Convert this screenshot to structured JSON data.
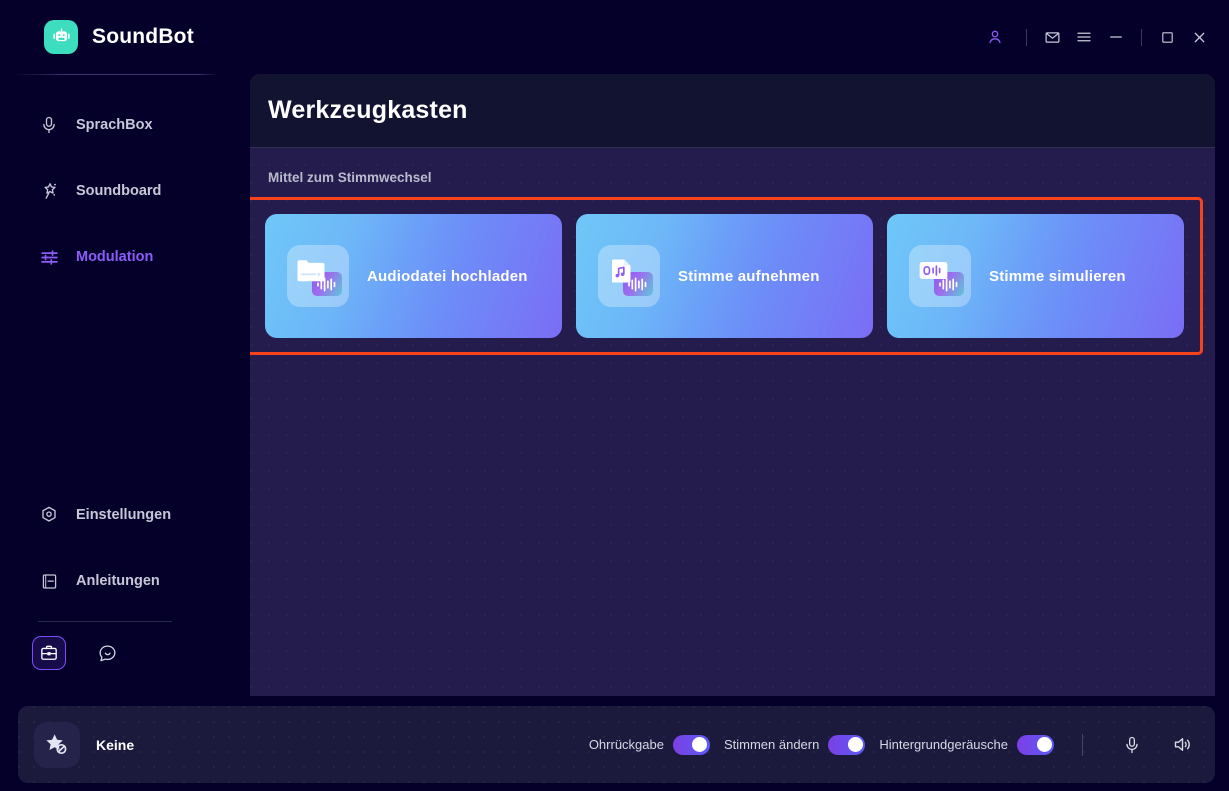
{
  "app": {
    "brand_name": "SoundBot",
    "logo_icon": "robot-icon",
    "logo_color": "#3DDDC0",
    "accent_color": "#8B5CF6",
    "highlight_color": "#F5441B"
  },
  "titlebar": {
    "controls": [
      {
        "name": "account-icon",
        "label": "Account"
      },
      {
        "name": "mail-icon",
        "label": "Mail"
      },
      {
        "name": "menu-icon",
        "label": "Menu"
      },
      {
        "name": "minimize-icon",
        "label": "Minimieren"
      },
      {
        "name": "maximize-icon",
        "label": "Maximieren"
      },
      {
        "name": "close-icon",
        "label": "Schließen"
      }
    ]
  },
  "sidebar": {
    "items": [
      {
        "label": "SprachBox",
        "icon": "microphone-icon",
        "active": false
      },
      {
        "label": "Soundboard",
        "icon": "magic-wand-icon",
        "active": false
      },
      {
        "label": "Modulation",
        "icon": "sliders-icon",
        "active": true
      }
    ],
    "bottom_items": [
      {
        "label": "Einstellungen",
        "icon": "gear-icon"
      },
      {
        "label": "Anleitungen",
        "icon": "book-icon"
      }
    ],
    "quick_buttons": [
      {
        "name": "toolbox-icon",
        "label": "Werkzeugkasten",
        "active": true
      },
      {
        "name": "chat-bubble-icon",
        "label": "Feedback",
        "active": false
      }
    ]
  },
  "main": {
    "title": "Werkzeugkasten",
    "section_label": "Mittel zum Stimmwechsel",
    "cards": [
      {
        "label": "Audiodatei hochladen",
        "icon": "folder-audio-icon"
      },
      {
        "label": "Stimme aufnehmen",
        "icon": "music-file-icon"
      },
      {
        "label": "Stimme simulieren",
        "icon": "voice-card-icon"
      }
    ]
  },
  "bottombar": {
    "voice_name": "Keine",
    "voice_icon": "star-disabled-icon",
    "toggles": [
      {
        "label": "Ohrrückgabe",
        "on": true
      },
      {
        "label": "Stimmen ändern",
        "on": true
      },
      {
        "label": "Hintergrundgeräusche",
        "on": true
      }
    ],
    "icons": [
      {
        "name": "microphone-icon",
        "label": "Mikrofon"
      },
      {
        "name": "speaker-icon",
        "label": "Lautsprecher"
      }
    ]
  }
}
